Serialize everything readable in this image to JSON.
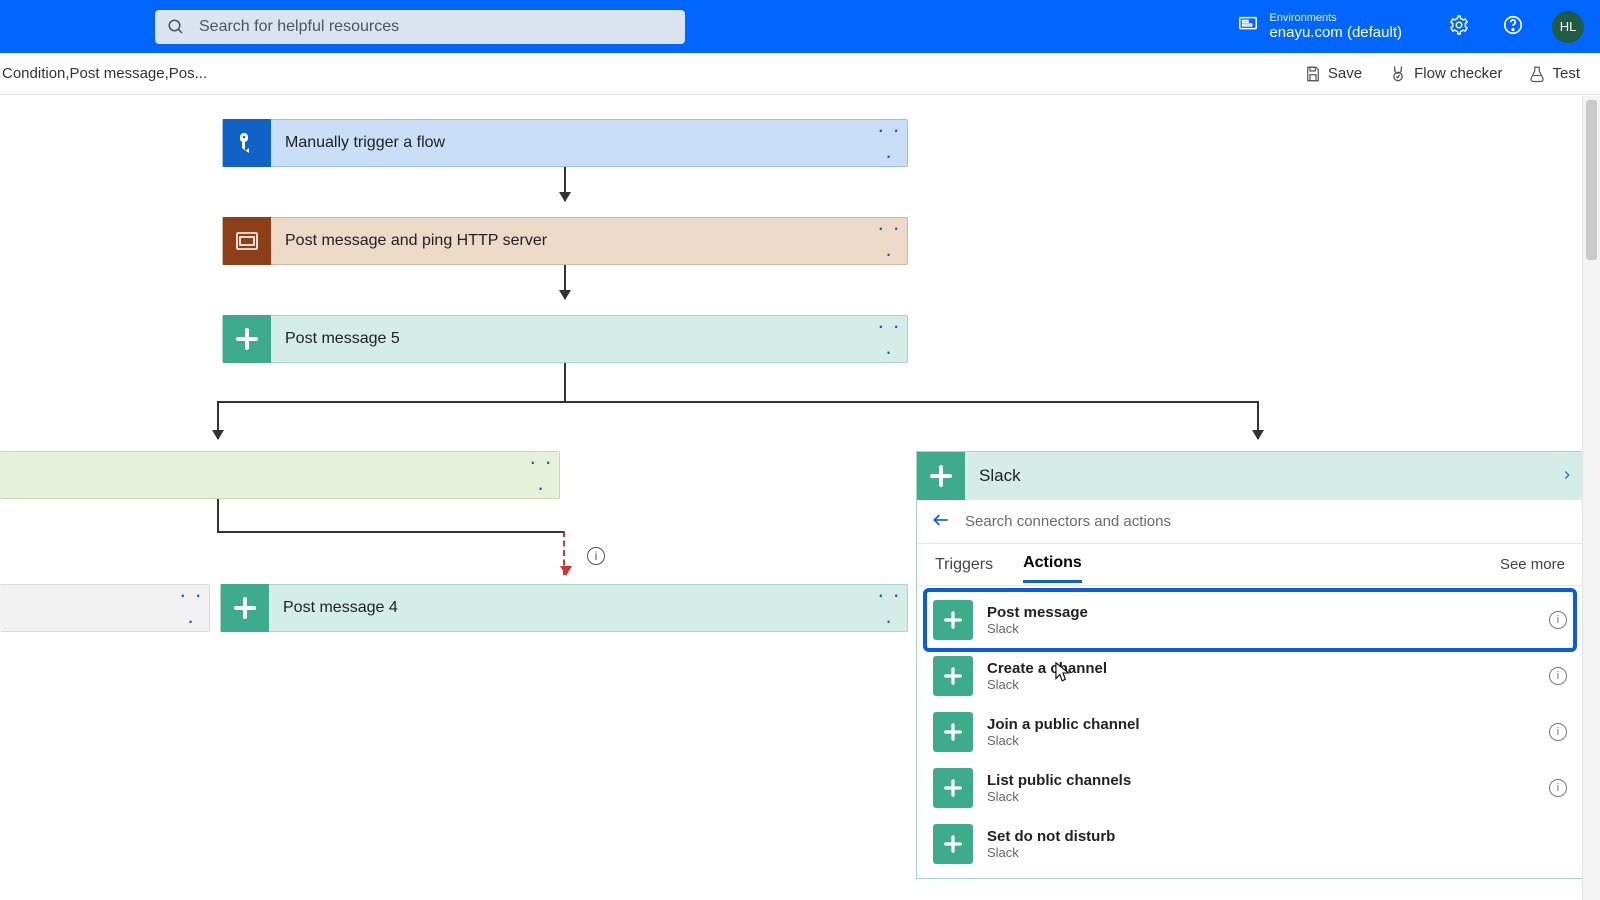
{
  "topbar": {
    "search_placeholder": "Search for helpful resources",
    "env_label": "Environments",
    "env_value": "enayu.com (default)",
    "avatar": "HL"
  },
  "cmdbar": {
    "breadcrumb": "Condition,Post message,Pos...",
    "save": "Save",
    "checker": "Flow checker",
    "test": "Test"
  },
  "flow": {
    "trigger": "Manually trigger a flow",
    "scope": "Post message and ping HTTP server",
    "slack1": "Post message 5",
    "slack2": "Post message 4"
  },
  "panel": {
    "connector": "Slack",
    "search_placeholder": "Search connectors and actions",
    "tab_triggers": "Triggers",
    "tab_actions": "Actions",
    "see_more": "See more",
    "items": [
      {
        "title": "Post message",
        "sub": "Slack"
      },
      {
        "title": "Create a channel",
        "sub": "Slack"
      },
      {
        "title": "Join a public channel",
        "sub": "Slack"
      },
      {
        "title": "List public channels",
        "sub": "Slack"
      },
      {
        "title": "Set do not disturb",
        "sub": "Slack"
      }
    ]
  }
}
